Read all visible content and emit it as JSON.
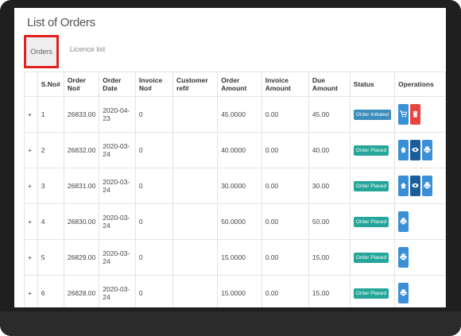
{
  "page": {
    "title": "List of Orders"
  },
  "tabs": [
    {
      "label": "Orders",
      "active": true
    },
    {
      "label": "Licence list",
      "active": false
    }
  ],
  "table": {
    "headers": [
      "",
      "S.No#",
      "Order No#",
      "Order Date",
      "Invoice No#",
      "Customer ref#",
      "Order Amount",
      "Invoice Amount",
      "Due Amount",
      "Status",
      "Operations"
    ],
    "rows": [
      {
        "expand": "+",
        "sno": "1",
        "order_no": "26833.00",
        "order_date": "2020-04-23",
        "invoice_no": "0",
        "customer_ref": "",
        "order_amount": "45.0000",
        "invoice_amount": "0.00",
        "due_amount": "45.00",
        "status": "Order Initiated"
      },
      {
        "expand": "+",
        "sno": "2",
        "order_no": "26832.00",
        "order_date": "2020-03-24",
        "invoice_no": "0",
        "customer_ref": "",
        "order_amount": "40.0000",
        "invoice_amount": "0.00",
        "due_amount": "40.00",
        "status": "Order Placed"
      },
      {
        "expand": "+",
        "sno": "3",
        "order_no": "26831.00",
        "order_date": "2020-03-24",
        "invoice_no": "0",
        "customer_ref": "",
        "order_amount": "30.0000",
        "invoice_amount": "0.00",
        "due_amount": "30.00",
        "status": "Order Placed"
      },
      {
        "expand": "+",
        "sno": "4",
        "order_no": "26830.00",
        "order_date": "2020-03-24",
        "invoice_no": "0",
        "customer_ref": "",
        "order_amount": "50.0000",
        "invoice_amount": "0.00",
        "due_amount": "50.00",
        "status": "Order Placed"
      },
      {
        "expand": "+",
        "sno": "5",
        "order_no": "26829.00",
        "order_date": "2020-03-24",
        "invoice_no": "0",
        "customer_ref": "",
        "order_amount": "15.0000",
        "invoice_amount": "0.00",
        "due_amount": "15.00",
        "status": "Order Placed"
      },
      {
        "expand": "+",
        "sno": "6",
        "order_no": "26828.00",
        "order_date": "2020-03-24",
        "invoice_no": "0",
        "customer_ref": "",
        "order_amount": "15.0000",
        "invoice_amount": "0.00",
        "due_amount": "15.00",
        "status": "Order Placed"
      }
    ]
  },
  "colors": {
    "status_initiated": "#3c8dbc",
    "status_placed": "#26a69a",
    "button_blue": "#3a8fd6",
    "button_dark_blue": "#1b5d9a",
    "button_red": "#e8453c",
    "tab_highlight": "#e3211e"
  }
}
